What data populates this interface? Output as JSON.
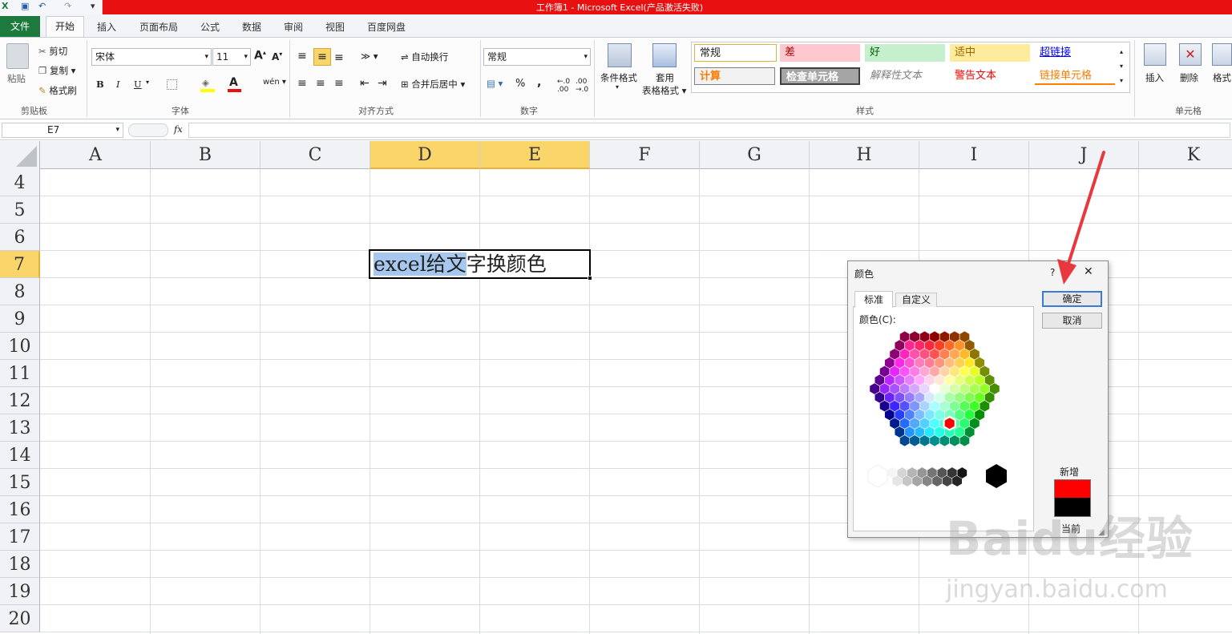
{
  "window": {
    "title": "工作簿1 - Microsoft Excel(产品激活失败)"
  },
  "tabs": {
    "file": "文件",
    "home": "开始",
    "insert": "插入",
    "layout": "页面布局",
    "formulas": "公式",
    "data": "数据",
    "review": "审阅",
    "view": "视图",
    "baidu": "百度网盘"
  },
  "clipboard": {
    "paste": "粘贴",
    "cut": "剪切",
    "copy": "复制",
    "painter": "格式刷",
    "label": "剪贴板"
  },
  "font": {
    "name": "宋体",
    "size": "11",
    "label": "字体",
    "bold": "B",
    "italic": "I",
    "underline": "U"
  },
  "align": {
    "wrap": "自动换行",
    "merge": "合并后居中",
    "label": "对齐方式"
  },
  "number": {
    "format": "常规",
    "percent": "%",
    "comma": ",",
    "label": "数字"
  },
  "styles": {
    "cond": "条件格式",
    "table1": "套用",
    "table2": "表格格式",
    "normal": "常规",
    "bad": "差",
    "good": "好",
    "neutral": "适中",
    "hyperlink": "超链接",
    "calc": "计算",
    "check": "检查单元格",
    "explanatory": "解释性文本",
    "warning": "警告文本",
    "linked": "链接单元格",
    "label": "样式"
  },
  "cells": {
    "insert": "插入",
    "delete": "删除",
    "format": "格式",
    "label": "单元格"
  },
  "formulabar": {
    "namebox": "E7",
    "fx": "fx"
  },
  "columns": [
    "A",
    "B",
    "C",
    "D",
    "E",
    "F",
    "G",
    "H",
    "I",
    "J",
    "K"
  ],
  "rows": [
    "4",
    "5",
    "6",
    "7",
    "8",
    "9",
    "10",
    "11",
    "12",
    "13",
    "14",
    "15",
    "16",
    "17",
    "18",
    "19",
    "20"
  ],
  "cell": {
    "selected_text": "excel给文",
    "rest_text": "字换颜色"
  },
  "dialog": {
    "title": "颜色",
    "help": "?",
    "close": "✕",
    "tab_standard": "标准",
    "tab_custom": "自定义",
    "colors_label": "颜色(C):",
    "ok": "确定",
    "cancel": "取消",
    "new_label": "新增",
    "current_label": "当前",
    "new_color": "#ff0000",
    "current_color": "#000000"
  },
  "watermark": {
    "brand": "Baidu经验",
    "url": "jingyan.baidu.com"
  }
}
